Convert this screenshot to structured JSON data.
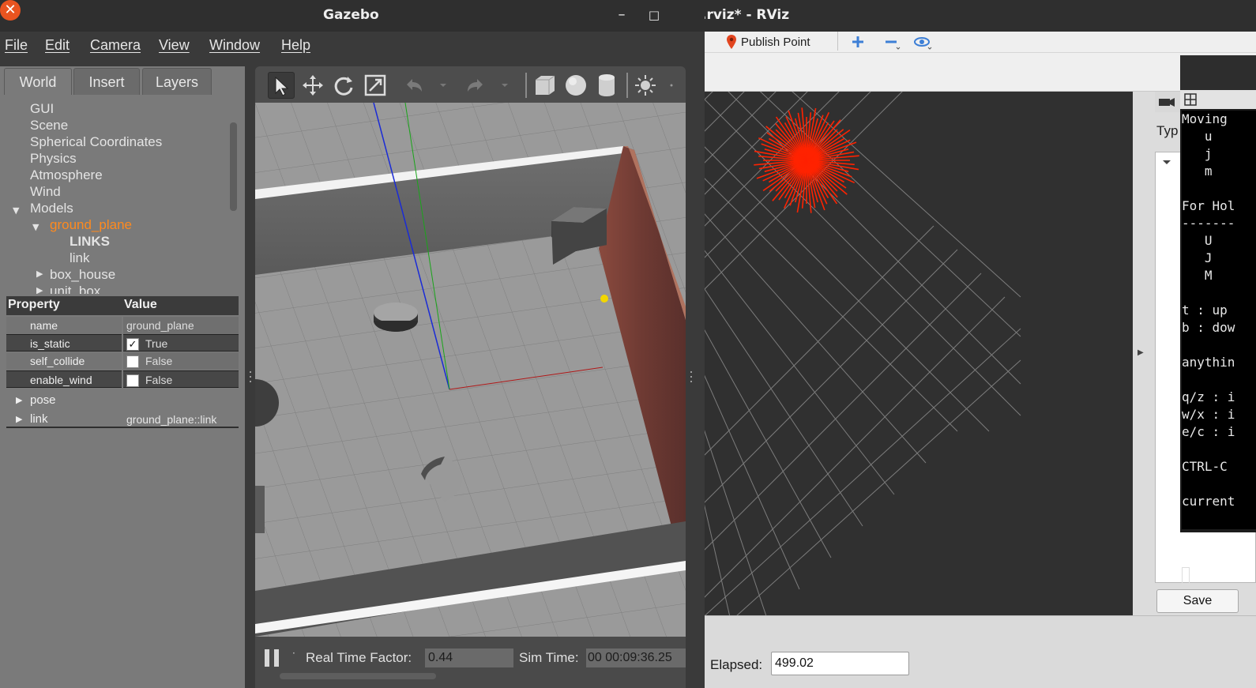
{
  "rviz": {
    "title": ".rviz* - RViz",
    "toolbar": {
      "publish_point_label": "Publish Point"
    },
    "panel": {
      "type_label": "Typ",
      "save_label": "Save"
    },
    "status": {
      "elapsed_label": "Elapsed:",
      "elapsed_value": "499.02"
    }
  },
  "terminal": {
    "lines": [
      "Moving",
      "   u",
      "   j",
      "   m",
      "",
      "For Hol",
      "-------",
      "   U",
      "   J",
      "   M",
      "",
      "t : up",
      "b : dow",
      "",
      "anythin",
      "",
      "q/z : i",
      "w/x : i",
      "e/c : i",
      "",
      "CTRL-C",
      "",
      "current"
    ]
  },
  "gazebo": {
    "title": "Gazebo",
    "window_buttons": {
      "minimize": "–",
      "maximize": "□",
      "close": "✕"
    },
    "menu": [
      "File",
      "Edit",
      "Camera",
      "View",
      "Window",
      "Help"
    ],
    "tabs": [
      "World",
      "Insert",
      "Layers"
    ],
    "tree": {
      "items": [
        "GUI",
        "Scene",
        "Spherical Coordinates",
        "Physics",
        "Atmosphere",
        "Wind",
        "Models"
      ],
      "models": {
        "ground_plane": "ground_plane",
        "links_header": "LINKS",
        "link": "link",
        "box_house": "box_house",
        "unit_box": "unit_box_..."
      }
    },
    "properties": {
      "header_property": "Property",
      "header_value": "Value",
      "rows": [
        {
          "name": "name",
          "value": "ground_plane"
        },
        {
          "name": "is_static",
          "value": "True",
          "checked": true
        },
        {
          "name": "self_collide",
          "value": "False",
          "checked": false
        },
        {
          "name": "enable_wind",
          "value": "False",
          "checked": false
        }
      ],
      "groups": [
        {
          "name": "pose",
          "value": ""
        },
        {
          "name": "link",
          "value": "ground_plane::link"
        }
      ]
    },
    "toolbar_icons": [
      "select-icon",
      "translate-icon",
      "rotate-icon",
      "scale-icon",
      "undo-icon",
      "redo-icon",
      "box-icon",
      "sphere-icon",
      "cylinder-icon",
      "light-icon"
    ],
    "bottom": {
      "rtf_label": "Real Time Factor:",
      "rtf_value": "0.44",
      "sim_label": "Sim Time:",
      "sim_value": "00 00:09:36.25"
    },
    "colors": {
      "selected": "#ff8a1e",
      "close_button": "#e95420"
    }
  }
}
